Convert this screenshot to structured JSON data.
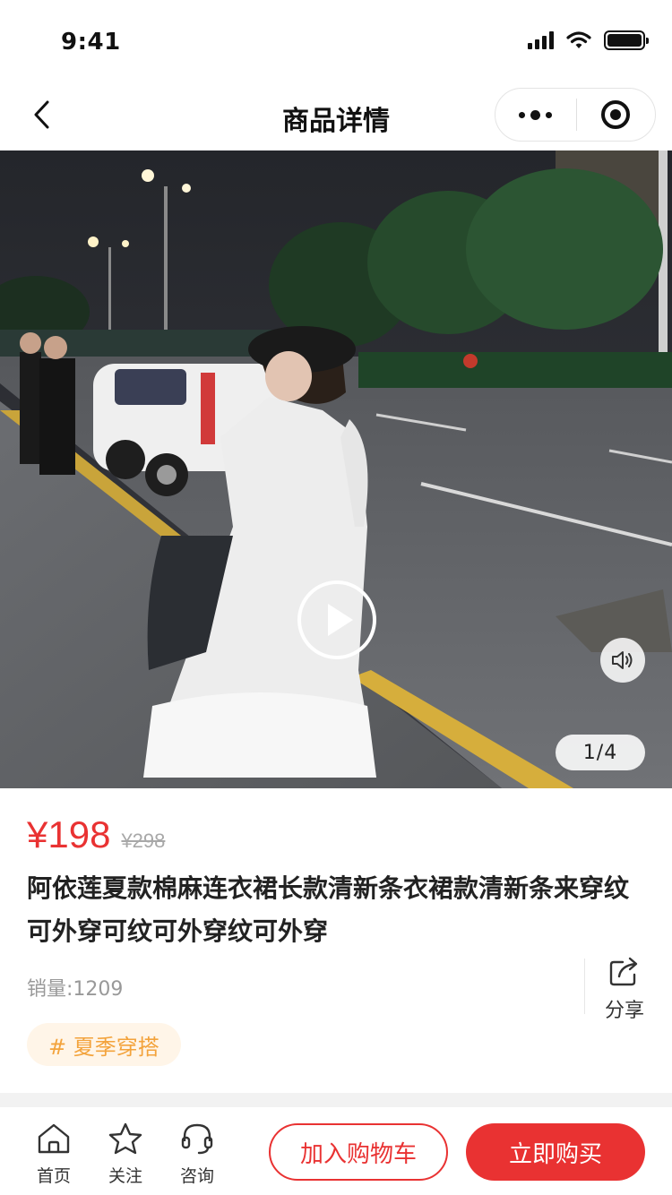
{
  "status_bar": {
    "time": "9:41"
  },
  "nav": {
    "title": "商品详情"
  },
  "media": {
    "page_indicator": "1/4"
  },
  "product": {
    "price": "¥198",
    "original_price": "¥298",
    "title": "阿依莲夏款棉麻连衣裙长款清新条衣裙款清新条来穿纹可外穿可纹可外穿纹可外穿",
    "sales": "销量:1209",
    "share_label": "分享",
    "tag": "# 夏季穿搭"
  },
  "bottom_bar": {
    "home_label": "首页",
    "follow_label": "关注",
    "consult_label": "咨询",
    "add_cart_label": "加入购物车",
    "buy_now_label": "立即购买"
  },
  "colors": {
    "accent": "#e93232",
    "tag_text": "#f3a33c",
    "tag_bg": "#fff5e8"
  },
  "icons": [
    "back-icon",
    "more-icon",
    "close-circle-icon",
    "play-icon",
    "volume-icon",
    "share-icon",
    "home-icon",
    "star-icon",
    "headset-icon"
  ]
}
